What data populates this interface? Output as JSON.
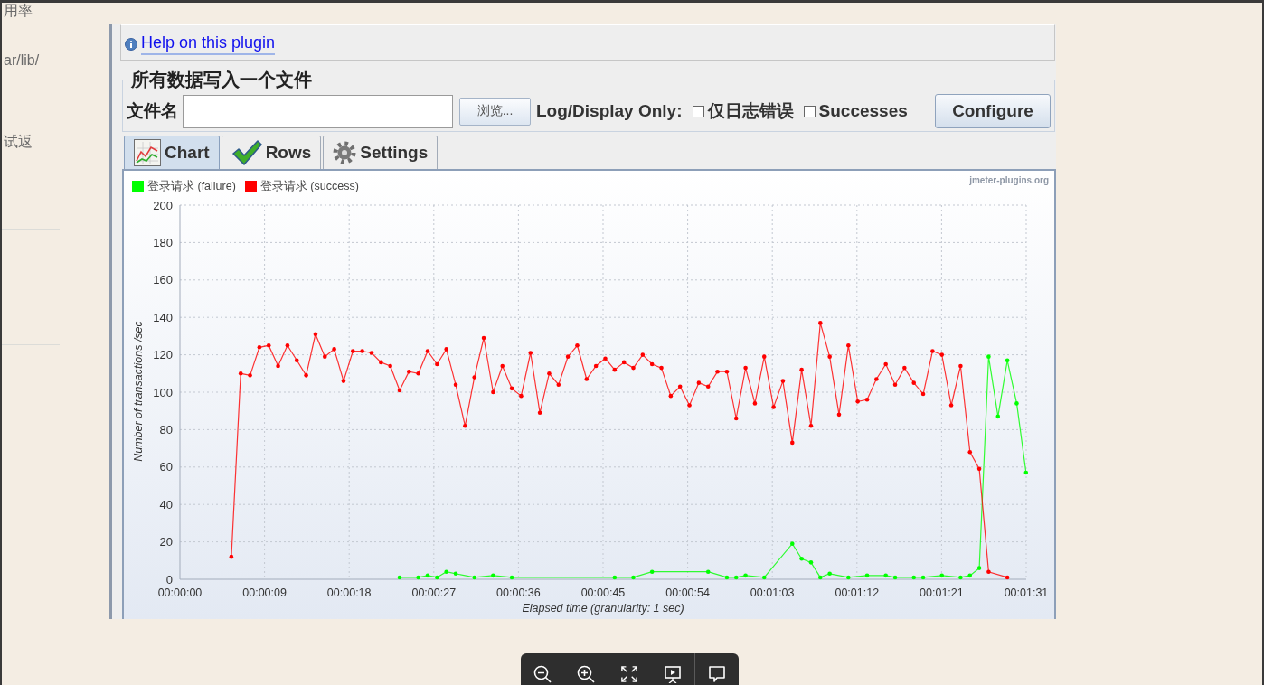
{
  "page": {
    "side_texts": [
      "用率",
      "ar/lib/",
      "试返"
    ]
  },
  "plugin": {
    "help_link": "Help on this plugin",
    "file_output": {
      "title": "所有数据写入一个文件",
      "filename_label": "文件名",
      "browse_button": "浏览...",
      "log_display_label": "Log/Display Only:",
      "checkboxes": [
        {
          "label": "仅日志错误",
          "checked": false
        },
        {
          "label": "Successes",
          "checked": false
        }
      ],
      "configure_button": "Configure"
    },
    "tabs": [
      {
        "label": "Chart",
        "selected": true
      },
      {
        "label": "Rows",
        "selected": false
      },
      {
        "label": "Settings",
        "selected": false
      }
    ],
    "chart": {
      "credit": "jmeter-plugins.org",
      "chart_data": {
        "type": "line",
        "xlabel": "Elapsed time (granularity: 1 sec)",
        "ylabel": "Number of transactions /sec",
        "grid": true,
        "legend": "top",
        "x": [
          5.5,
          6.5,
          7.5,
          8.5,
          9.5,
          10.5,
          11.5,
          12.5,
          13.5,
          14.5,
          15.5,
          16.5,
          17.5,
          18.5,
          19.5,
          20.5,
          21.5,
          22.5,
          23.5,
          24.5,
          25.5,
          26.5,
          27.5,
          28.5,
          29.5,
          30.5,
          31.5,
          32.5,
          33.5,
          34.5,
          35.5,
          36.5,
          37.5,
          38.5,
          39.5,
          40.5,
          41.5,
          42.5,
          43.5,
          44.5,
          45.5,
          46.5,
          47.5,
          48.5,
          49.5,
          50.5,
          51.5,
          52.5,
          53.5,
          54.5,
          55.5,
          56.5,
          57.5,
          58.5,
          59.5,
          60.5,
          61.5,
          62.5,
          63.5,
          64.5,
          65.5,
          66.5,
          67.5,
          68.5,
          69.5,
          70.5,
          71.5,
          72.5,
          73.5,
          74.5,
          75.5,
          76.5,
          77.5,
          78.5,
          79.5,
          80.5,
          81.5,
          82.5,
          83.5,
          84.5,
          85.5,
          86.5,
          87.5,
          88.5,
          89.5,
          90.5
        ],
        "series": [
          {
            "name": "登录请求 (failure)",
            "color": "#00ff00",
            "values": [
              null,
              null,
              null,
              null,
              null,
              null,
              null,
              null,
              null,
              null,
              null,
              null,
              null,
              null,
              null,
              null,
              null,
              null,
              1,
              null,
              1,
              2,
              1,
              4,
              3,
              null,
              1,
              null,
              2,
              null,
              1,
              null,
              null,
              null,
              null,
              null,
              null,
              null,
              null,
              null,
              null,
              1,
              null,
              1,
              null,
              4,
              null,
              null,
              null,
              null,
              null,
              4,
              null,
              1,
              1,
              2,
              null,
              1,
              null,
              null,
              19,
              11,
              9,
              1,
              3,
              null,
              1,
              null,
              2,
              null,
              2,
              1,
              null,
              1,
              1,
              null,
              2,
              null,
              1,
              2,
              6,
              119,
              87,
              117,
              94,
              57
            ]
          },
          {
            "name": "登录请求 (success)",
            "color": "#ff0000",
            "values": [
              12,
              110,
              109,
              124,
              125,
              114,
              125,
              117,
              109,
              131,
              119,
              123,
              106,
              122,
              122,
              121,
              116,
              114,
              101,
              111,
              110,
              122,
              115,
              123,
              104,
              82,
              108,
              129,
              100,
              114,
              102,
              98,
              121,
              89,
              110,
              104,
              119,
              125,
              107,
              114,
              118,
              112,
              116,
              113,
              120,
              115,
              113,
              98,
              103,
              93,
              105,
              103,
              111,
              111,
              86,
              113,
              94,
              119,
              92,
              106,
              73,
              112,
              82,
              137,
              119,
              88,
              125,
              95,
              96,
              107,
              115,
              104,
              113,
              105,
              99,
              122,
              120,
              93,
              114,
              68,
              59,
              4,
              null,
              1,
              null,
              null
            ]
          }
        ],
        "xlim": [
          0,
          90.52
        ],
        "ylim": [
          0,
          200
        ],
        "xticks": [
          {
            "value": 0,
            "label": "00:00:00"
          },
          {
            "value": 9.052,
            "label": "00:00:09"
          },
          {
            "value": 18.104,
            "label": "00:00:18"
          },
          {
            "value": 27.156,
            "label": "00:00:27"
          },
          {
            "value": 36.208,
            "label": "00:00:36"
          },
          {
            "value": 45.26,
            "label": "00:00:45"
          },
          {
            "value": 54.312,
            "label": "00:00:54"
          },
          {
            "value": 63.364,
            "label": "00:01:03"
          },
          {
            "value": 72.416,
            "label": "00:01:12"
          },
          {
            "value": 81.468,
            "label": "00:01:21"
          },
          {
            "value": 90.52,
            "label": "00:01:31"
          }
        ],
        "yticks": [
          0,
          20,
          40,
          60,
          80,
          100,
          120,
          140,
          160,
          180,
          200
        ]
      }
    }
  }
}
